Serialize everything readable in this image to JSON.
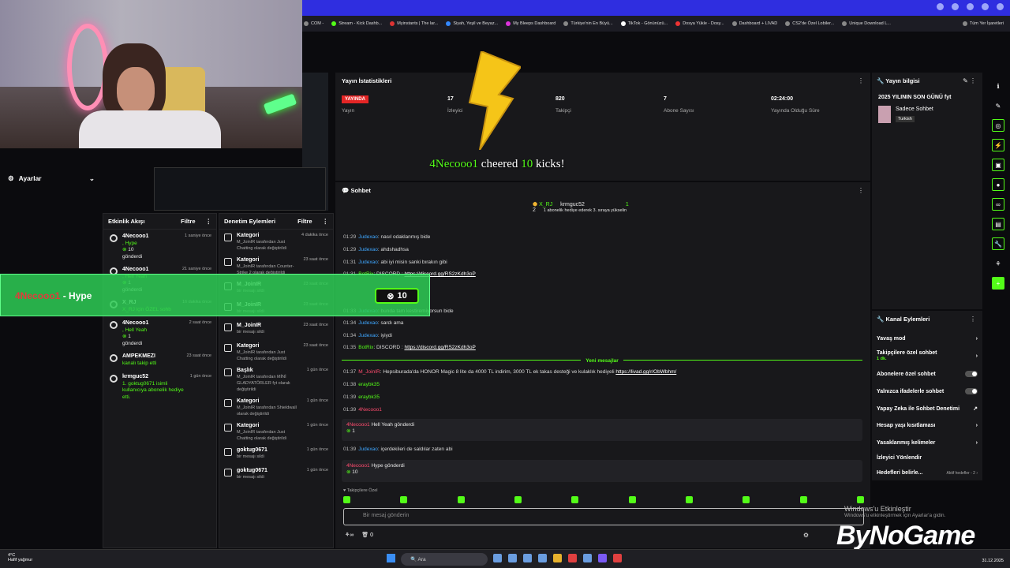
{
  "bookmarks": [
    "COM -",
    "Stream - Kick Dashb...",
    "Myinstants | The lar...",
    "Siyah, Yeşil ve Beyaz...",
    "My Bleeps Dashboard",
    "Türkiye'nin En Büyü...",
    "TikTok - Gönünüzü...",
    "Dosya Yükle - Dosy...",
    "Dashboard + LIVAD",
    "CS2'de Özel Lobiler...",
    "Unique Download L...",
    "Tüm Yer İşaretleri"
  ],
  "settings_label": "Ayarlar",
  "activity": {
    "title": "Etkinlik Akışı",
    "filter": "Filtre",
    "items": [
      {
        "user": "4Necooo1",
        "line1": ", Hype",
        "amount": "10",
        "line2": "gönderdi",
        "time": "1 saniye önce"
      },
      {
        "user": "4Necooo1",
        "line1": ", Hell Yeah",
        "amount": "1",
        "line2": "gönderdi",
        "time": "21 saniye önce"
      },
      {
        "user": "X_RJ",
        "line1": "X_RJ için ÖZEL sohb",
        "amount": "",
        "line2": "",
        "time": "16 dakika önce"
      },
      {
        "user": "4Necooo1",
        "line1": ", Hell Yeah",
        "amount": "1",
        "line2": "gönderdi",
        "time": "2 saat önce"
      },
      {
        "user": "AMPEKMEZI",
        "line1": "kanalı takip etti",
        "amount": "",
        "line2": "",
        "time": "23 saat önce"
      },
      {
        "user": "krmguc52",
        "line1": "1. goktug0671 isimli kullanıcıya abonelik hediye etti.",
        "amount": "",
        "line2": "",
        "time": "1 gün önce"
      }
    ]
  },
  "moderation": {
    "title": "Denetim Eylemleri",
    "filter": "Filtre",
    "items": [
      {
        "head": "Kategori",
        "body": "M_JoinIR tarafından Just Chatting olarak değiştirildi",
        "time": "4 dakika önce"
      },
      {
        "head": "Kategori",
        "body": "M_JoinIR tarafından Counter-Strike 2 olarak değiştirildi",
        "time": "23 saat önce"
      },
      {
        "head": "M_JoinIR",
        "body": "bir mesajı sildi",
        "time": "23 saat önce"
      },
      {
        "head": "M_JoinIR",
        "body": "bir mesajı sildi",
        "time": "23 saat önce"
      },
      {
        "head": "M_JoinIR",
        "body": "bir mesajı sildi",
        "time": "23 saat önce"
      },
      {
        "head": "Kategori",
        "body": "M_JoinIR tarafından Just Chatting olarak değiştirildi",
        "time": "23 saat önce"
      },
      {
        "head": "Başlık",
        "body": "M_JoinIR tarafından MİNİ GLADYATÖRLER fyt olarak değiştirildi",
        "time": "1 gün önce"
      },
      {
        "head": "Kategori",
        "body": "M_JoinIR tarafından Shieldwall olarak değiştirildi",
        "time": "1 gün önce"
      },
      {
        "head": "Kategori",
        "body": "M_JoinIR tarafından Just Chatting olarak değiştirildi",
        "time": "1 gün önce"
      },
      {
        "head": "goktug0671",
        "body": "bir mesajı sildi",
        "time": "1 gün önce"
      },
      {
        "head": "goktug0671",
        "body": "bir mesajı sildi",
        "time": "1 gün önce"
      }
    ]
  },
  "hype_alert": {
    "user": "4Necooo1",
    "text": "- Hype",
    "amount": "10"
  },
  "stats": {
    "title": "Yayın İstatistikleri",
    "live": "YAYINDA",
    "live_label": "Yayın",
    "viewers": "17",
    "viewers_label": "İzleyici",
    "followers": "820",
    "followers_label": "Takipçi",
    "subs": "7",
    "subs_label": "Abone Sayısı",
    "duration": "02:24:00",
    "duration_label": "Yayında Olduğu Süre"
  },
  "cheer": {
    "user": "4Necooo1",
    "mid": "cheered",
    "amount": "10",
    "tail": "kicks!"
  },
  "chat": {
    "title": "Sohbet",
    "pin_user1": "X_RJ",
    "pin_user2": "krmguc52",
    "pin_text": "1 abonelik hediye ederek 3. sıraya yükselin",
    "pin_count": "1",
    "pin_count2": "2",
    "lines": [
      {
        "t": "01:29",
        "u": "Judexao",
        "m": ": nasıl odaklanmış bide"
      },
      {
        "t": "01:29",
        "u": "Judexao",
        "m": ": ahdshadhsa"
      },
      {
        "t": "01:31",
        "u": "Judexao",
        "m": ": abi iyi misin sanki bırakın gibi"
      },
      {
        "t": "01:31",
        "u": "BotRix",
        "m": ": DISCORD : ",
        "link": "https://discord.gg/RS2zKdh3oP"
      },
      {
        "t": "01:33",
        "u": "Judexao",
        "m": ": bunda tam kestiremiyorsun bide"
      },
      {
        "t": "01:34",
        "u": "Judexao",
        "m": ": sardı ama"
      },
      {
        "t": "01:34",
        "u": "Judexao",
        "m": ": iyiydi"
      },
      {
        "t": "01:35",
        "u": "BotRix",
        "m": ": DISCORD : ",
        "link": "https://discord.gg/RS2zKdh3oP"
      }
    ],
    "new_messages": "Yeni mesajlar",
    "promo": {
      "t": "01:37",
      "u": "M_JoinIR",
      "m": ": Hepsiburada'da HONOR Magic 8 lite da 4000 TL indirim, 3000 TL ek takas desteği ve kulaklık hediyeli ",
      "link": "https://livad.gg/r/ObWbhm/"
    },
    "small": [
      {
        "t": "01:38",
        "u": "eraybk35"
      },
      {
        "t": "01:39",
        "u": "eraybk35"
      },
      {
        "t": "01:39",
        "u": "4Necooo1"
      }
    ],
    "gift1": {
      "user": "4Necooo1",
      "text": "Hell Yeah gönderdi",
      "amount": "1"
    },
    "line_after": {
      "t": "01:39",
      "u": "Judexao",
      "m": ": içerdekileri de saldılar zaten abi"
    },
    "gift2": {
      "user": "4Necooo1",
      "text": "Hype gönderdi",
      "amount": "10"
    },
    "followers_only": "Takipçilere Özel",
    "placeholder": "Bir mesaj gönderin",
    "footer_count": "0"
  },
  "info": {
    "title": "Yayın bilgisi",
    "stream_title": "2025 YILININ SON GÜNÜ fyt",
    "category": "Sadece Sohbet",
    "lang": "Turkish"
  },
  "channel": {
    "title": "Kanal Eylemleri",
    "rows": [
      "Yavaş mod",
      "Takipçilere özel sohbet",
      "Abonelere özel sohbet",
      "Yalnızca ifadelerle sohbet",
      "Yapay Zeka ile Sohbet Denetimi",
      "Hesap yaşı kısıtlaması",
      "Yasaklanmış kelimeler",
      "İzleyici Yönlendir",
      "Hedefleri belirle..."
    ],
    "sub1": "1 dk.",
    "goal_tag": "Aktif hedefler - 2"
  },
  "taskbar": {
    "temp": "4°C",
    "weather": "Hafif yağmur",
    "search": "Ara",
    "time": "",
    "date": "31.12.2025"
  },
  "watermark": {
    "l1": "Windows'u Etkinleştir",
    "l2": "Windows'u etkinleştirmek için Ayarlar'a gidin."
  },
  "brand": "ByNoGame"
}
